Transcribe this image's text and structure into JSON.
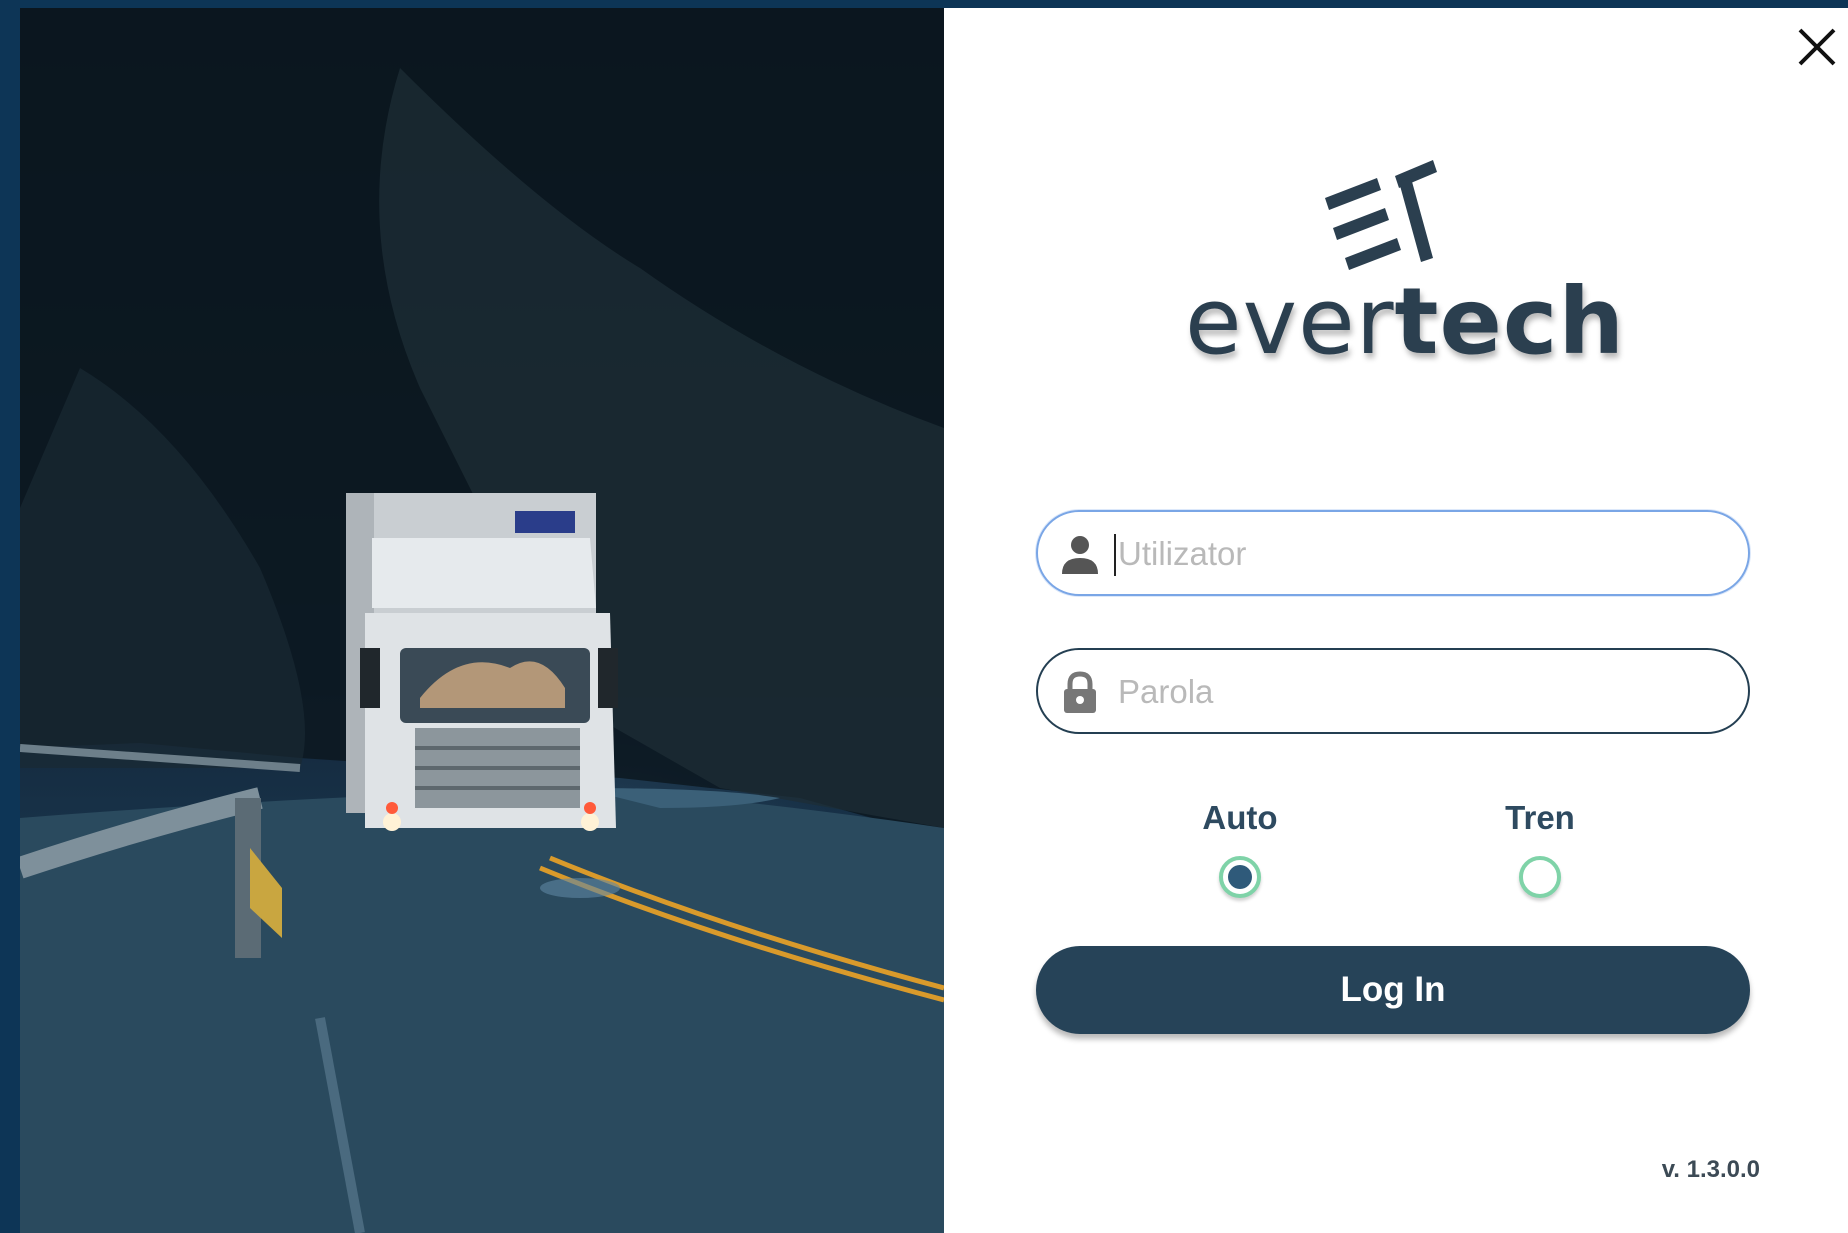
{
  "window": {
    "close_icon": "close-icon",
    "accent_color": "#264358",
    "focus_color": "#7aa6e6",
    "radio_color": "#7fd3a8"
  },
  "brand": {
    "name_light": "ever",
    "name_bold": "tech",
    "logo_icon": "evertech-logo-mark"
  },
  "form": {
    "username": {
      "placeholder": "Utilizator",
      "value": "",
      "icon": "user-icon"
    },
    "password": {
      "placeholder": "Parola",
      "value": "",
      "icon": "lock-icon"
    },
    "transport": {
      "options": [
        {
          "label": "Auto",
          "checked": true
        },
        {
          "label": "Tren",
          "checked": false
        }
      ]
    },
    "submit_label": "Log In"
  },
  "footer": {
    "version": "v. 1.3.0.0"
  }
}
